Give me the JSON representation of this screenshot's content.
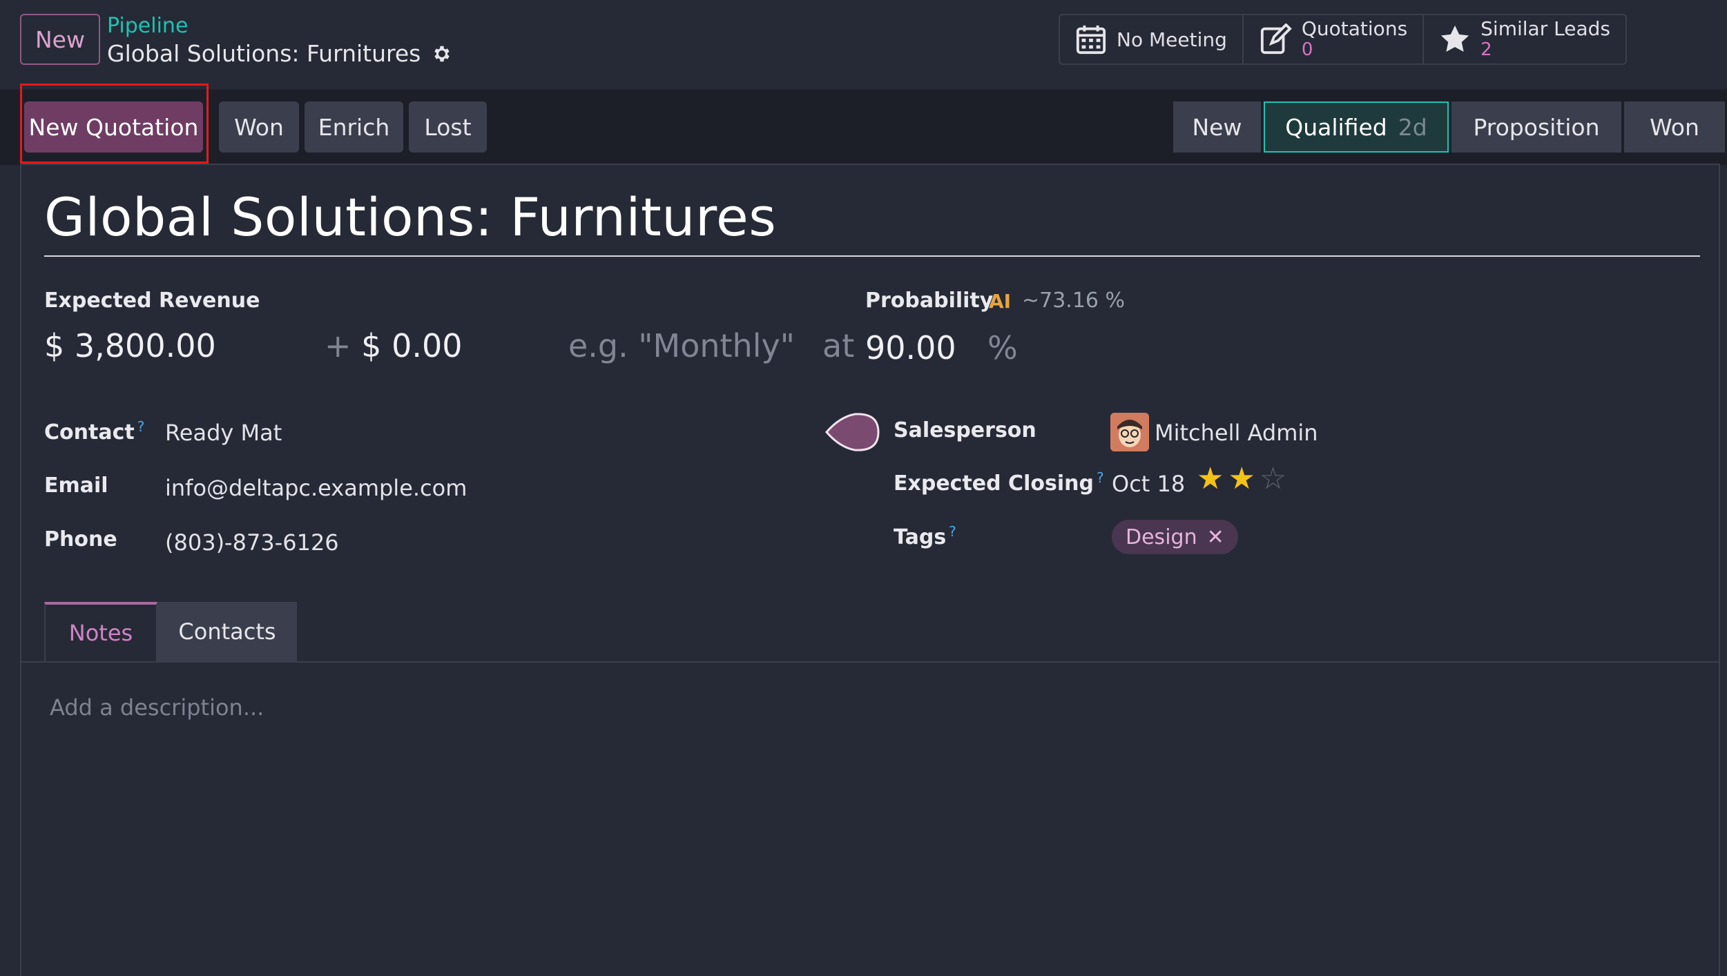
{
  "header": {
    "new_button": "New",
    "breadcrumb": "Pipeline",
    "record_title": "Global Solutions: Furnitures"
  },
  "smart_buttons": {
    "meeting": {
      "label": "No Meeting"
    },
    "quotations": {
      "label": "Quotations",
      "count": "0"
    },
    "similar_leads": {
      "label": "Similar Leads",
      "count": "2"
    }
  },
  "actions": {
    "new_quotation": "New Quotation",
    "won": "Won",
    "enrich": "Enrich",
    "lost": "Lost"
  },
  "stages": [
    {
      "label": "New"
    },
    {
      "label": "Qualified",
      "duration": "2d",
      "active": true
    },
    {
      "label": "Proposition"
    },
    {
      "label": "Won"
    }
  ],
  "form": {
    "lead_name": "Global Solutions: Furnitures",
    "expected_revenue": {
      "label": "Expected Revenue",
      "currency": "$",
      "value": "3,800.00",
      "plus": "+",
      "recurring_value": "0.00",
      "period_placeholder": "e.g. \"Monthly\"",
      "at": "at"
    },
    "probability": {
      "label": "Probability",
      "ai_label": "AI",
      "ai_value": "~73.16 %",
      "value": "90.00",
      "unit": "%"
    },
    "contact": {
      "label": "Contact",
      "help": "?",
      "value": "Ready Mat"
    },
    "email": {
      "label": "Email",
      "value": "info@deltapc.example.com"
    },
    "phone": {
      "label": "Phone",
      "value": "(803)-873-6126"
    },
    "salesperson": {
      "label": "Salesperson",
      "value": "Mitchell Admin"
    },
    "expected_closing": {
      "label": "Expected Closing",
      "help": "?",
      "value": "Oct 18",
      "priority_stars": 2,
      "priority_max": 3
    },
    "tags": {
      "label": "Tags",
      "help": "?",
      "items": [
        {
          "label": "Design",
          "remove": "✕"
        }
      ]
    }
  },
  "tabs": [
    {
      "label": "Notes",
      "active": true
    },
    {
      "label": "Contacts",
      "active": false
    }
  ],
  "notes": {
    "placeholder": "Add a description..."
  },
  "colors": {
    "accent": "#714b67",
    "teal": "#1ec2b4",
    "background": "#262a36",
    "highlight": "#e01b1b"
  }
}
